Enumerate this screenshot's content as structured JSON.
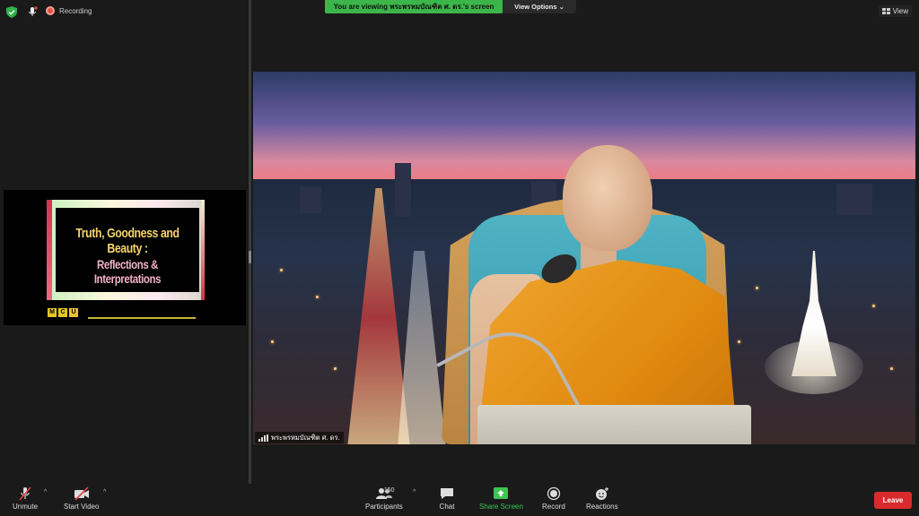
{
  "topbar": {
    "recording_label": "Recording",
    "viewing_banner": "You are viewing พระพรหมบัณฑิต ศ. ดร.'s screen",
    "view_options_label": "View Options ⌄",
    "view_label": "View"
  },
  "shared_slide": {
    "title_line1": "Truth, Goodness and Beauty :",
    "title_line2": "Reflections & Interpretations",
    "logo_letters": [
      "M",
      "C",
      "U"
    ]
  },
  "main_video": {
    "participant_name": "พระพรหมบัณฑิต ศ. ดร."
  },
  "toolbar": {
    "unmute_label": "Unmute",
    "start_video_label": "Start Video",
    "participants_label": "Participants",
    "participants_count": "150",
    "chat_label": "Chat",
    "share_screen_label": "Share Screen",
    "record_label": "Record",
    "reactions_label": "Reactions",
    "leave_label": "Leave"
  },
  "colors": {
    "banner_green": "#3cb54a",
    "leave_red": "#d92b2b",
    "share_green": "#3cc552",
    "recording_red": "#e25241"
  }
}
